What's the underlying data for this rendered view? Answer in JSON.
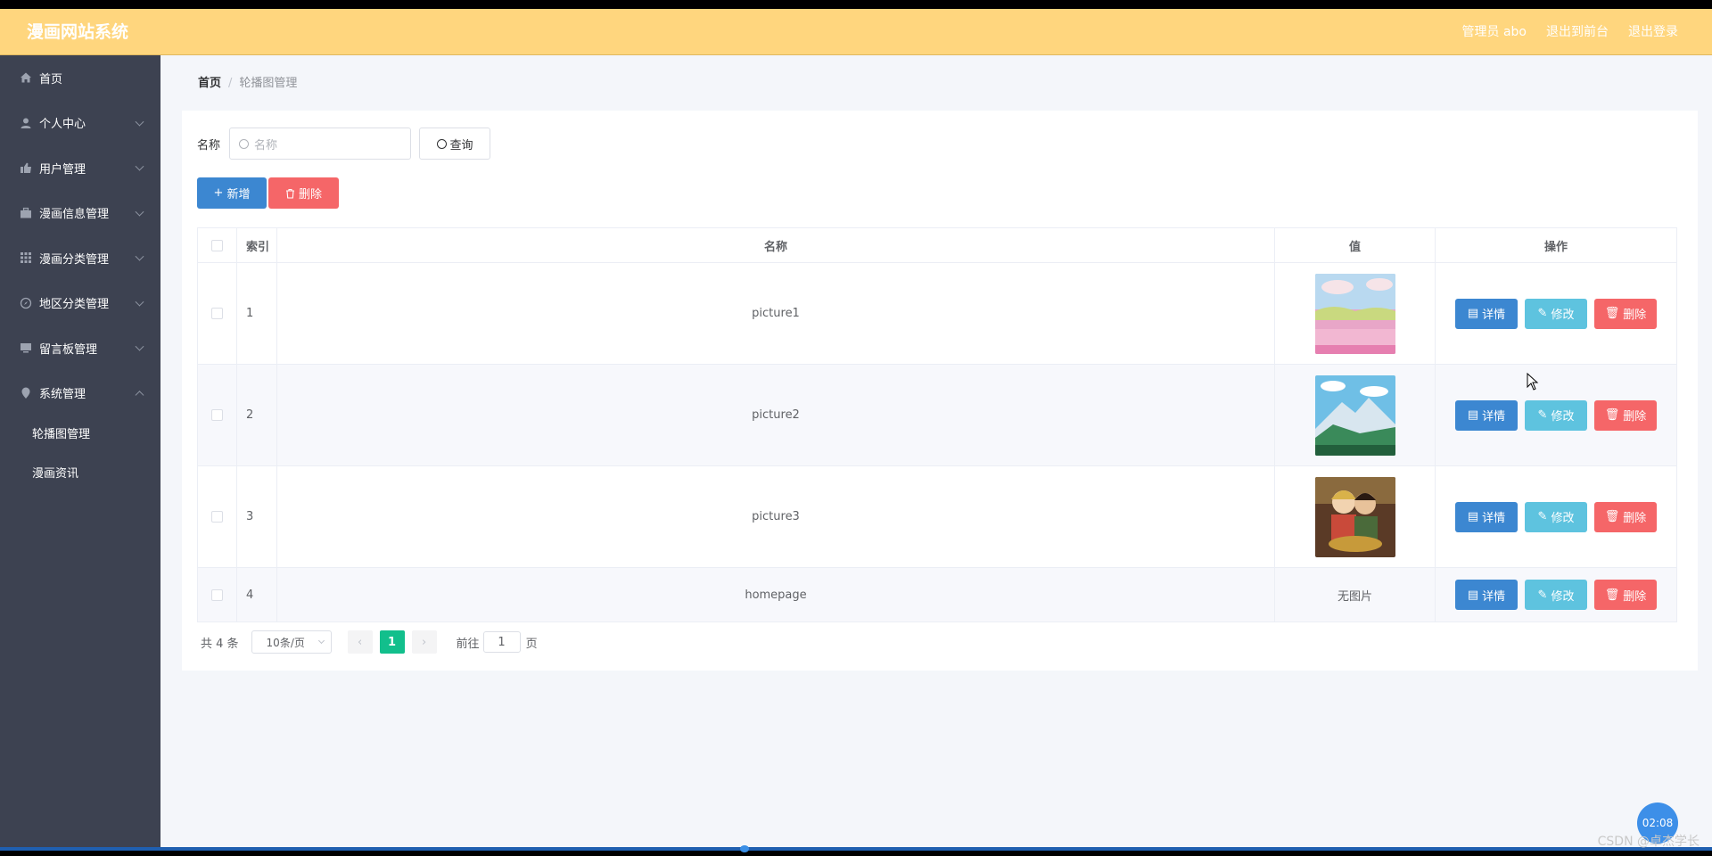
{
  "header": {
    "brand": "漫画网站系统",
    "admin": "管理员 abo",
    "back_front": "退出到前台",
    "logout": "退出登录"
  },
  "sidebar": {
    "items": [
      {
        "label": "首页",
        "icon": "home-icon"
      },
      {
        "label": "个人中心",
        "icon": "user-icon"
      },
      {
        "label": "用户管理",
        "icon": "thumb-icon"
      },
      {
        "label": "漫画信息管理",
        "icon": "briefcase-icon"
      },
      {
        "label": "漫画分类管理",
        "icon": "grid-icon"
      },
      {
        "label": "地区分类管理",
        "icon": "compass-icon"
      },
      {
        "label": "留言板管理",
        "icon": "monitor-icon"
      },
      {
        "label": "系统管理",
        "icon": "location-icon"
      }
    ],
    "sub_items": [
      "轮播图管理",
      "漫画资讯"
    ]
  },
  "breadcrumb": {
    "home": "首页",
    "sep": "/",
    "current": "轮播图管理"
  },
  "search": {
    "label": "名称",
    "placeholder": "名称",
    "button": "查询"
  },
  "actions": {
    "add": "新增",
    "delete": "删除"
  },
  "table": {
    "headers": {
      "index": "索引",
      "name": "名称",
      "value": "值",
      "ops": "操作"
    },
    "rows": [
      {
        "index": "1",
        "name": "picture1",
        "value": "",
        "has_image": true
      },
      {
        "index": "2",
        "name": "picture2",
        "value": "",
        "has_image": true
      },
      {
        "index": "3",
        "name": "picture3",
        "value": "",
        "has_image": true
      },
      {
        "index": "4",
        "name": "homepage",
        "value": "无图片",
        "has_image": false
      }
    ],
    "op_labels": {
      "detail": "详情",
      "edit": "修改",
      "remove": "删除"
    }
  },
  "pager": {
    "total": "共 4 条",
    "size": "10条/页",
    "current": "1",
    "goto": "前往",
    "goto_value": "1",
    "page_unit": "页"
  },
  "overlay": {
    "timer": "02:08",
    "watermark": "CSDN @卓杰学长"
  },
  "colors": {
    "header": "#ffd67e",
    "sidebar": "#3d4251",
    "primary": "#3c87d1",
    "danger": "#f56668",
    "info": "#5ec3df",
    "pager_active": "#12bf8c"
  }
}
